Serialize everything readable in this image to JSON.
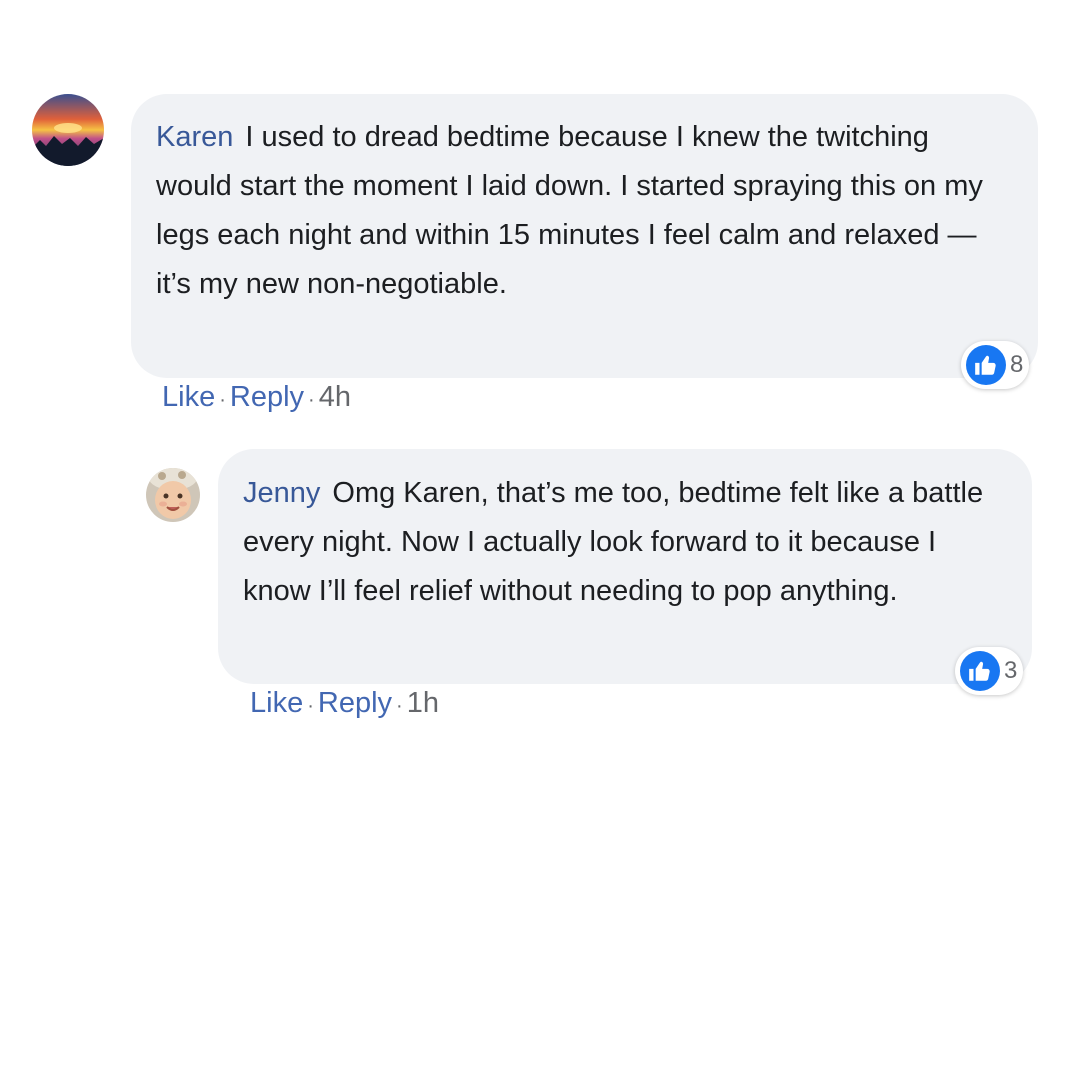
{
  "comments": [
    {
      "author": "Karen",
      "text": "I used to dread bedtime because I knew the twitching would start the moment I laid down. I started spraying this on my legs each night and within 15 minutes I feel calm and relaxed — it’s my new non-negotiable.",
      "reaction_icon": "like-icon",
      "reaction_count": "8",
      "like_label": "Like",
      "reply_label": "Reply",
      "separator": "·",
      "timestamp": "4h"
    },
    {
      "author": "Jenny",
      "text": "Omg Karen, that’s me too, bedtime felt like a battle every night. Now I actually look forward to it because I know I’ll feel relief without needing to pop anything.",
      "reaction_icon": "like-icon",
      "reaction_count": "3",
      "like_label": "Like",
      "reply_label": "Reply",
      "separator": "·",
      "timestamp": "1h"
    }
  ],
  "colors": {
    "author": "#385898",
    "link": "#4267b2",
    "like_badge": "#1877f2",
    "bubble": "#f0f2f5"
  }
}
